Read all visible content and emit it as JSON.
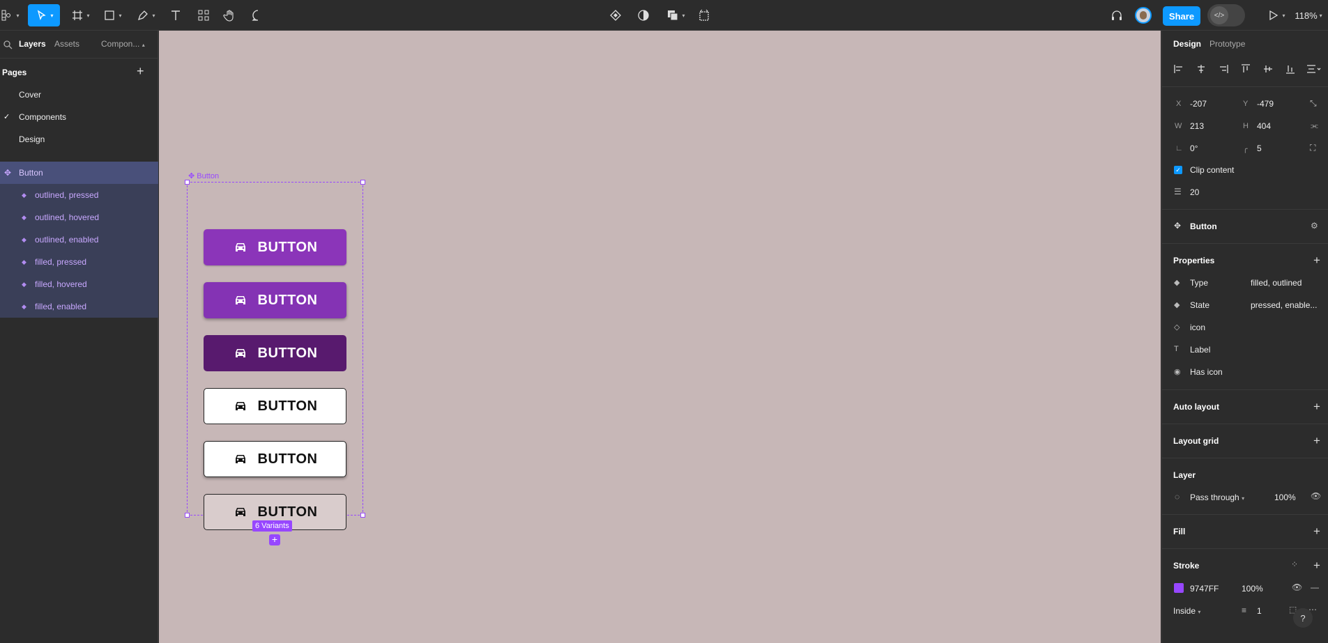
{
  "toolbar": {
    "share_label": "Share",
    "zoom": "118%",
    "icons": [
      "figma-menu-icon",
      "move-tool-icon",
      "frame-tool-icon",
      "shape-tool-icon",
      "pen-tool-icon",
      "text-tool-icon",
      "resources-icon",
      "hand-tool-icon",
      "comment-tool-icon",
      "component-icon",
      "contrast-icon",
      "boolean-icon",
      "crop-icon",
      "headphones-icon",
      "dev-mode-toggle-icon",
      "play-icon"
    ]
  },
  "left_panel": {
    "tabs": [
      "Layers",
      "Assets",
      "Compon..."
    ],
    "pages_heading": "Pages",
    "pages": [
      "Cover",
      "Components",
      "Design"
    ],
    "current_page": "Components",
    "component_set": "Button",
    "variants": [
      "outlined, pressed",
      "outlined, hovered",
      "outlined, enabled",
      "filled, pressed",
      "filled, hovered",
      "filled, enabled"
    ]
  },
  "canvas": {
    "frame_label": "Button",
    "button_label": "BUTTON",
    "variant_count_label": "6 Variants",
    "add_variant": "+",
    "background": "#c7b7b7",
    "selection_color": "#9747ff"
  },
  "right_panel": {
    "tabs": [
      "Design",
      "Prototype"
    ],
    "x_label": "X",
    "x": "-207",
    "y_label": "Y",
    "y": "-479",
    "w_label": "W",
    "w": "213",
    "h_label": "H",
    "h": "404",
    "rotation": "0°",
    "corner_radius": "5",
    "clip_content": "Clip content",
    "spacing": "20",
    "component_name": "Button",
    "properties_heading": "Properties",
    "properties": [
      {
        "icon": "variant-icon",
        "name": "Type",
        "value": "filled, outlined"
      },
      {
        "icon": "variant-icon",
        "name": "State",
        "value": "pressed, enable..."
      },
      {
        "icon": "instance-swap-icon",
        "name": "icon",
        "value": ""
      },
      {
        "icon": "text-property-icon",
        "name": "Label",
        "value": ""
      },
      {
        "icon": "boolean-property-icon",
        "name": "Has icon",
        "value": ""
      }
    ],
    "auto_layout": "Auto layout",
    "layout_grid": "Layout grid",
    "layer_heading": "Layer",
    "blend_mode": "Pass through",
    "layer_opacity": "100%",
    "fill_heading": "Fill",
    "stroke_heading": "Stroke",
    "stroke_color": "9747FF",
    "stroke_opacity": "100%",
    "stroke_position": "Inside",
    "stroke_weight": "1",
    "help": "?"
  }
}
